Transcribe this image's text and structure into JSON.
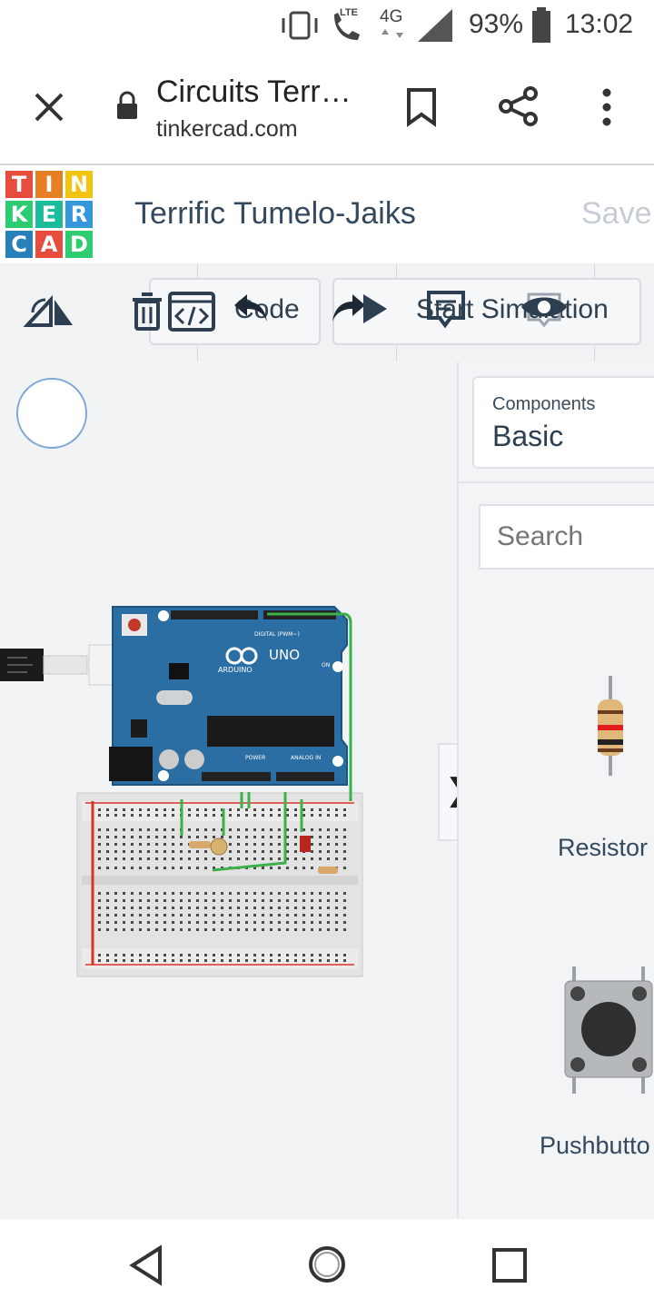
{
  "status_bar": {
    "network_label": "4G",
    "lte_label": "LTE",
    "battery": "93%",
    "time": "13:02",
    "icons": [
      "vibrate-icon",
      "call-lte-icon",
      "signal-icon",
      "battery-icon"
    ]
  },
  "browser": {
    "title": "Circuits Terr…",
    "domain": "tinkercad.com",
    "icons": [
      "close-icon",
      "lock-icon",
      "bookmark-icon",
      "share-icon",
      "more-icon"
    ]
  },
  "app": {
    "logo_letters": [
      "T",
      "I",
      "N",
      "K",
      "E",
      "R",
      "C",
      "A",
      "D"
    ],
    "logo_colors": [
      "#e74c3c",
      "#e67e22",
      "#f1c40f",
      "#2ecc71",
      "#1abc9c",
      "#3498db",
      "#2980b9",
      "#e74c3c",
      "#2ecc71"
    ],
    "project_name": "Terrific Tumelo-Jaiks",
    "save_status": "Save"
  },
  "toolbar": {
    "code_label": "Code",
    "simulation_label": "Start Simulation",
    "icons": [
      "rotate-icon",
      "delete-icon",
      "code-icon",
      "undo-icon",
      "redo-icon",
      "play-icon",
      "note-icon",
      "eye-icon"
    ]
  },
  "panel": {
    "components_label": "Components",
    "category": "Basic",
    "search_placeholder": "Search",
    "items": [
      {
        "label": "Resistor",
        "icon": "resistor-icon"
      },
      {
        "label": "Pushbutto",
        "icon": "pushbutton-icon"
      }
    ],
    "collapse_glyph": "❯"
  },
  "board": {
    "brand": "ARDUINO",
    "model": "UNO",
    "digital_label": "DIGITAL (PWM~)",
    "power_label": "POWER",
    "analog_label": "ANALOG IN",
    "on_label": "ON"
  },
  "colors": {
    "accent_blue": "#1f6ea0",
    "board_blue": "#2b6ea3",
    "wire_green": "#3cb04a",
    "wire_red": "#d9342b",
    "text_dark": "#34495e",
    "saved_grey": "#c6ccd3"
  },
  "nav": {
    "icons": [
      "back-icon",
      "home-icon",
      "recents-icon"
    ]
  }
}
